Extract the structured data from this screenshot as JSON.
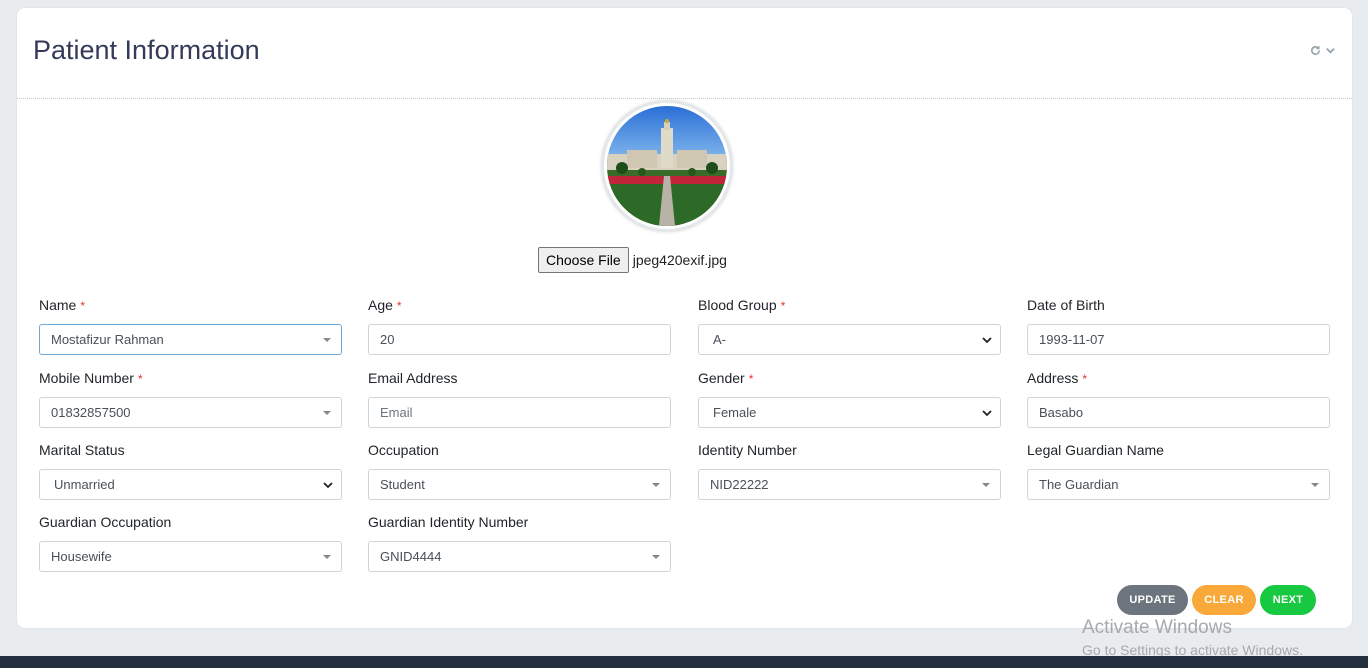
{
  "card": {
    "title": "Patient Information",
    "tools": {
      "refresh_icon": "refresh-icon",
      "collapse_icon": "chevron-down-icon"
    }
  },
  "photo": {
    "alt": "Patient photo"
  },
  "file_input": {
    "button_label": "Choose File",
    "file_name": "jpeg420exif.jpg"
  },
  "form": {
    "name": {
      "label": "Name",
      "value": "Mostafizur Rahman",
      "required": true
    },
    "age": {
      "label": "Age",
      "value": "20",
      "required": true
    },
    "blood_group": {
      "label": "Blood Group",
      "value": "A-",
      "required": true
    },
    "dob": {
      "label": "Date of Birth",
      "value": "1993-11-07"
    },
    "mobile": {
      "label": "Mobile Number",
      "value": "01832857500",
      "required": true
    },
    "email": {
      "label": "Email Address",
      "placeholder": "Email"
    },
    "gender": {
      "label": "Gender",
      "value": "Female",
      "required": true
    },
    "address": {
      "label": "Address",
      "value": "Basabo",
      "required": true
    },
    "marital": {
      "label": "Marital Status",
      "value": "Unmarried"
    },
    "occupation": {
      "label": "Occupation",
      "value": "Student"
    },
    "identity": {
      "label": "Identity Number",
      "value": "NID22222"
    },
    "guardian_name": {
      "label": "Legal Guardian Name",
      "value": "The Guardian"
    },
    "guardian_occupation": {
      "label": "Guardian Occupation",
      "value": "Housewife"
    },
    "guardian_identity": {
      "label": "Guardian Identity Number",
      "value": "GNID4444"
    },
    "required_mark": "*"
  },
  "actions": {
    "update": "UPDATE",
    "clear": "CLEAR",
    "next": "NEXT"
  },
  "watermark": {
    "line1": "Activate Windows",
    "line2": "Go to Settings to activate Windows."
  },
  "colors": {
    "update": "#6c757d",
    "clear": "#f9a93a",
    "next": "#17c940",
    "required": "#e3342f",
    "title": "#343a5a"
  }
}
